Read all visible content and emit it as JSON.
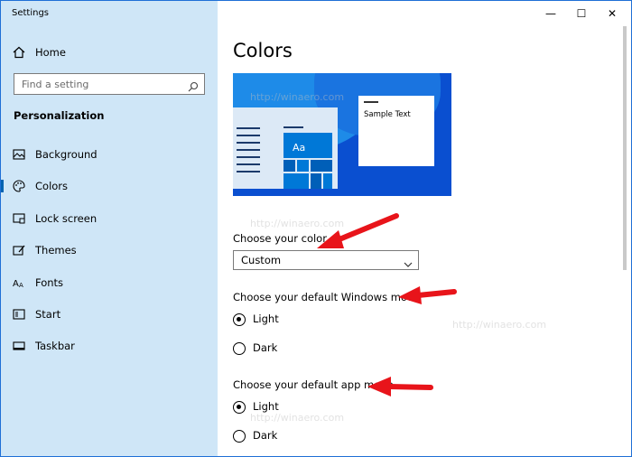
{
  "window": {
    "title": "Settings",
    "controls": {
      "minimize": "—",
      "maximize": "☐",
      "close": "✕"
    }
  },
  "sidebar": {
    "home_label": "Home",
    "search_placeholder": "Find a setting",
    "section_title": "Personalization",
    "items": [
      {
        "label": "Background",
        "icon": "picture-icon"
      },
      {
        "label": "Colors",
        "icon": "palette-icon",
        "active": true
      },
      {
        "label": "Lock screen",
        "icon": "lock-screen-icon"
      },
      {
        "label": "Themes",
        "icon": "brush-icon"
      },
      {
        "label": "Fonts",
        "icon": "font-icon"
      },
      {
        "label": "Start",
        "icon": "start-icon"
      },
      {
        "label": "Taskbar",
        "icon": "taskbar-icon"
      }
    ]
  },
  "main": {
    "title": "Colors",
    "preview": {
      "sample_text": "Sample Text",
      "tile_text": "Aa"
    },
    "choose_color": {
      "label": "Choose your color",
      "value": "Custom"
    },
    "windows_mode": {
      "label": "Choose your default Windows mode",
      "options": [
        "Light",
        "Dark"
      ],
      "selected": "Light"
    },
    "app_mode": {
      "label": "Choose your default app mode",
      "options": [
        "Light",
        "Dark"
      ],
      "selected": "Light"
    }
  },
  "watermark_text": "http://winaero.com",
  "colors": {
    "sidebar_bg": "#cfe6f7",
    "accent": "#0063b1",
    "arrow": "#e8141a",
    "preview_bg": "#0a4fd0"
  }
}
